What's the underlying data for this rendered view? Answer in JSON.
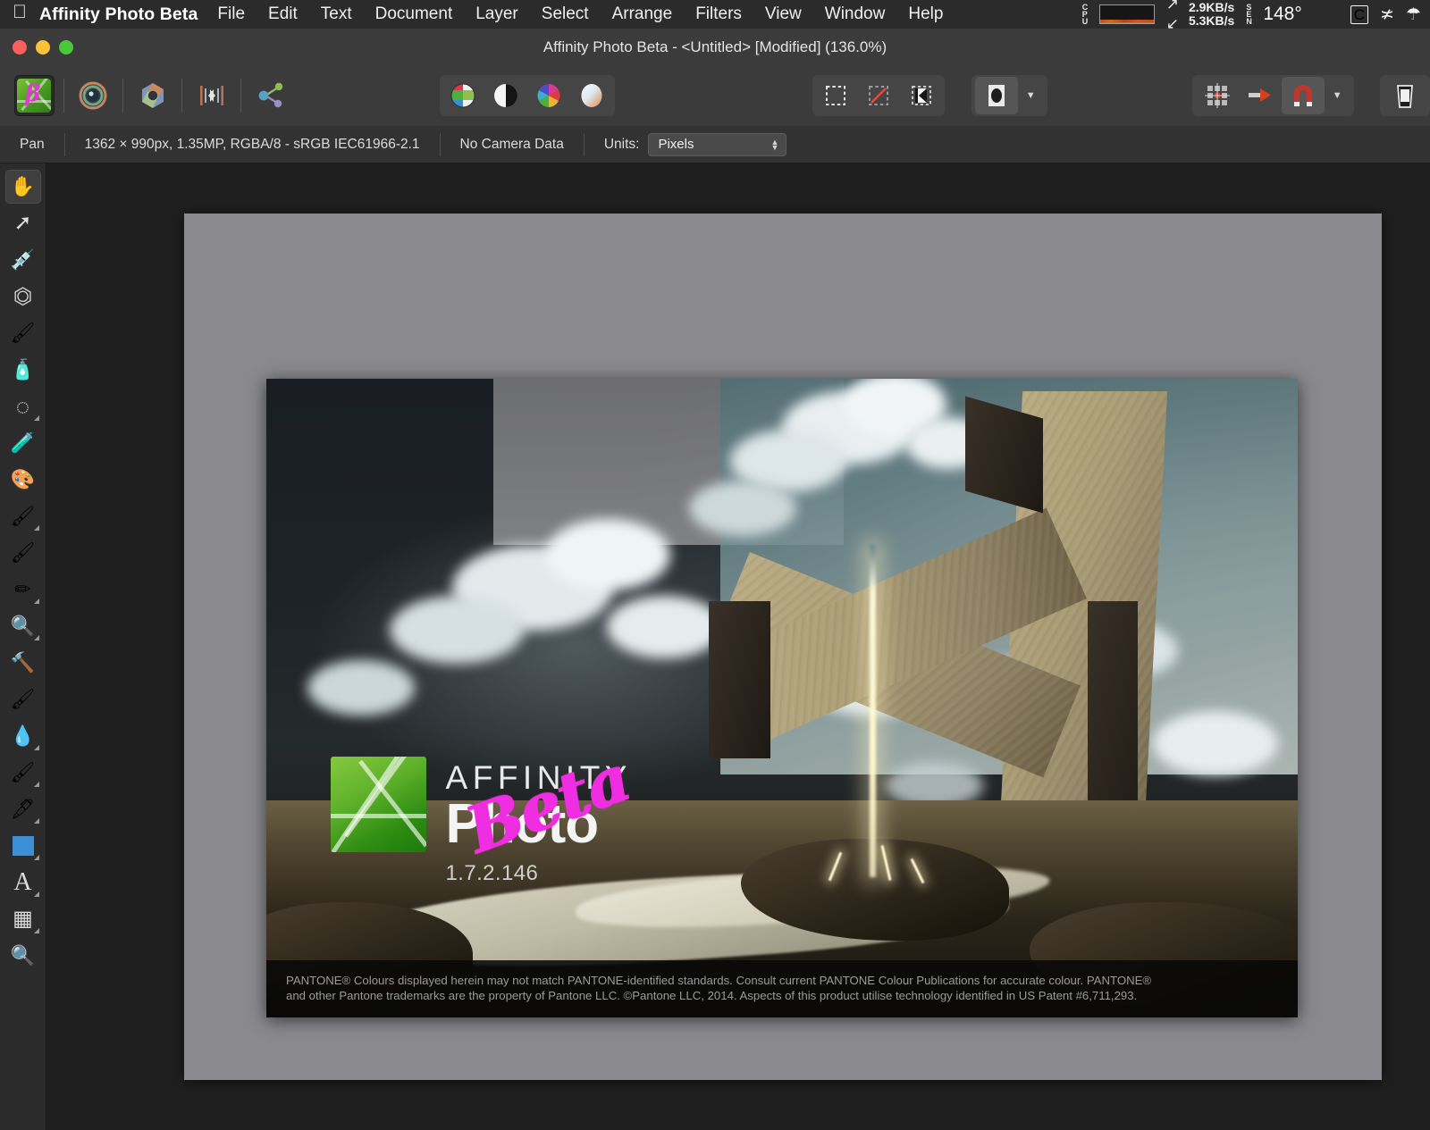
{
  "menubar": {
    "apple_icon": "apple-logo-icon",
    "app_name": "Affinity Photo Beta",
    "items": [
      "File",
      "Edit",
      "Text",
      "Document",
      "Layer",
      "Select",
      "Arrange",
      "Filters",
      "View",
      "Window",
      "Help"
    ],
    "status": {
      "cpu_label": "CPU",
      "net_down": "2.9KB/s",
      "net_up": "5.3KB/s",
      "sensor_label": "SEN",
      "temperature": "148°",
      "c_badge": "C",
      "wifi_icon": "wifi-icon",
      "bluetooth_icon": "bluetooth-icon",
      "expand_icon": "expand-arrows-icon"
    }
  },
  "window": {
    "title": "Affinity Photo Beta - <Untitled> [Modified] (136.0%)",
    "traffic": {
      "close": "close-button",
      "minimize": "minimize-button",
      "zoom": "zoom-button"
    }
  },
  "toolbar": {
    "personas": [
      {
        "name": "photo-persona",
        "selected": true
      },
      {
        "name": "liquify-persona",
        "selected": false
      },
      {
        "name": "develop-persona",
        "selected": false
      },
      {
        "name": "tone-mapping-persona",
        "selected": false
      },
      {
        "name": "export-persona",
        "selected": false
      }
    ],
    "adjustments": [
      {
        "name": "colour-picker-swatch"
      },
      {
        "name": "levels-adjustment"
      },
      {
        "name": "colour-wheel-adjustment"
      },
      {
        "name": "gradient-adjustment"
      }
    ],
    "selection_tools": [
      {
        "name": "marquee-selection"
      },
      {
        "name": "deselect-selection"
      },
      {
        "name": "refine-selection"
      }
    ],
    "mask_button": {
      "name": "mask-layer",
      "has_dropdown": true
    },
    "snapping": [
      {
        "name": "grid-snap"
      },
      {
        "name": "move-to-front"
      },
      {
        "name": "magnet-snapping",
        "active": true,
        "has_dropdown": true
      }
    ],
    "trash_button": {
      "name": "delete-button"
    }
  },
  "infobar": {
    "tool_name": "Pan",
    "document_info": "1362 × 990px, 1.35MP, RGBA/8 - sRGB IEC61966-2.1",
    "camera_data": "No Camera Data",
    "units_label": "Units:",
    "units_value": "Pixels"
  },
  "tools": [
    {
      "name": "view-pan-tool",
      "glyph": "✋",
      "selected": true,
      "sub": false
    },
    {
      "name": "move-tool",
      "glyph": "↖",
      "selected": false,
      "sub": false
    },
    {
      "name": "colour-picker-tool",
      "glyph": "💉",
      "selected": false,
      "sub": false
    },
    {
      "name": "crop-tool",
      "glyph": "⛶",
      "selected": false,
      "sub": false
    },
    {
      "name": "selection-brush-tool",
      "glyph": "🖌",
      "selected": false,
      "sub": false
    },
    {
      "name": "flood-select-tool",
      "glyph": "🪄",
      "selected": false,
      "sub": false
    },
    {
      "name": "elliptical-marquee-tool",
      "glyph": "◌",
      "selected": false,
      "sub": true
    },
    {
      "name": "flood-fill-tool",
      "glyph": "🪣",
      "selected": false,
      "sub": false
    },
    {
      "name": "gradient-tool",
      "glyph": "🎨",
      "selected": false,
      "sub": false
    },
    {
      "name": "paint-brush-tool",
      "glyph": "🖌",
      "selected": false,
      "sub": true
    },
    {
      "name": "pixel-tool",
      "glyph": "🖌",
      "selected": false,
      "sub": false
    },
    {
      "name": "erase-brush-tool",
      "glyph": "✏",
      "selected": false,
      "sub": true
    },
    {
      "name": "dodge-brush-tool",
      "glyph": "🔍",
      "selected": false,
      "sub": true
    },
    {
      "name": "clone-brush-tool",
      "glyph": "🔨",
      "selected": false,
      "sub": false
    },
    {
      "name": "undo-brush-tool",
      "glyph": "🖌",
      "selected": false,
      "sub": false
    },
    {
      "name": "blur-brush-tool",
      "glyph": "💧",
      "selected": false,
      "sub": true
    },
    {
      "name": "smudge-brush-tool",
      "glyph": "🖌",
      "selected": false,
      "sub": true
    },
    {
      "name": "pen-tool",
      "glyph": "🖊",
      "selected": false,
      "sub": true
    },
    {
      "name": "rectangle-tool",
      "glyph": "▢",
      "selected": false,
      "sub": true
    },
    {
      "name": "artistic-text-tool",
      "glyph": "A",
      "selected": false,
      "sub": true
    },
    {
      "name": "mesh-warp-tool",
      "glyph": "▦",
      "selected": false,
      "sub": true
    },
    {
      "name": "zoom-tool",
      "glyph": "🔍",
      "selected": false,
      "sub": false
    }
  ],
  "splash": {
    "brand_top": "AFFINITY",
    "brand_main": "Photo",
    "version": "1.7.2.146",
    "beta_scribble": "Beta",
    "legal_line1": "PANTONE® Colours displayed herein may not match PANTONE-identified standards. Consult current PANTONE Colour Publications for accurate colour. PANTONE®",
    "legal_line2": "and other Pantone trademarks are the property of Pantone LLC. ©Pantone LLC, 2014. Aspects of this product utilise technology identified in US Patent #6,711,293."
  },
  "colors": {
    "menubar_bg": "#2b2b2b",
    "titlebar_bg": "#3b3b3b",
    "infobar_bg": "#323232",
    "workspace_bg": "#1f1f1f",
    "canvas_bg": "#8a8a8e",
    "splash_bg": "#1a1e22",
    "beta_magenta": "#ee2ee0",
    "affinity_green": "#5fb12b",
    "accent_red": "#d4401f"
  }
}
